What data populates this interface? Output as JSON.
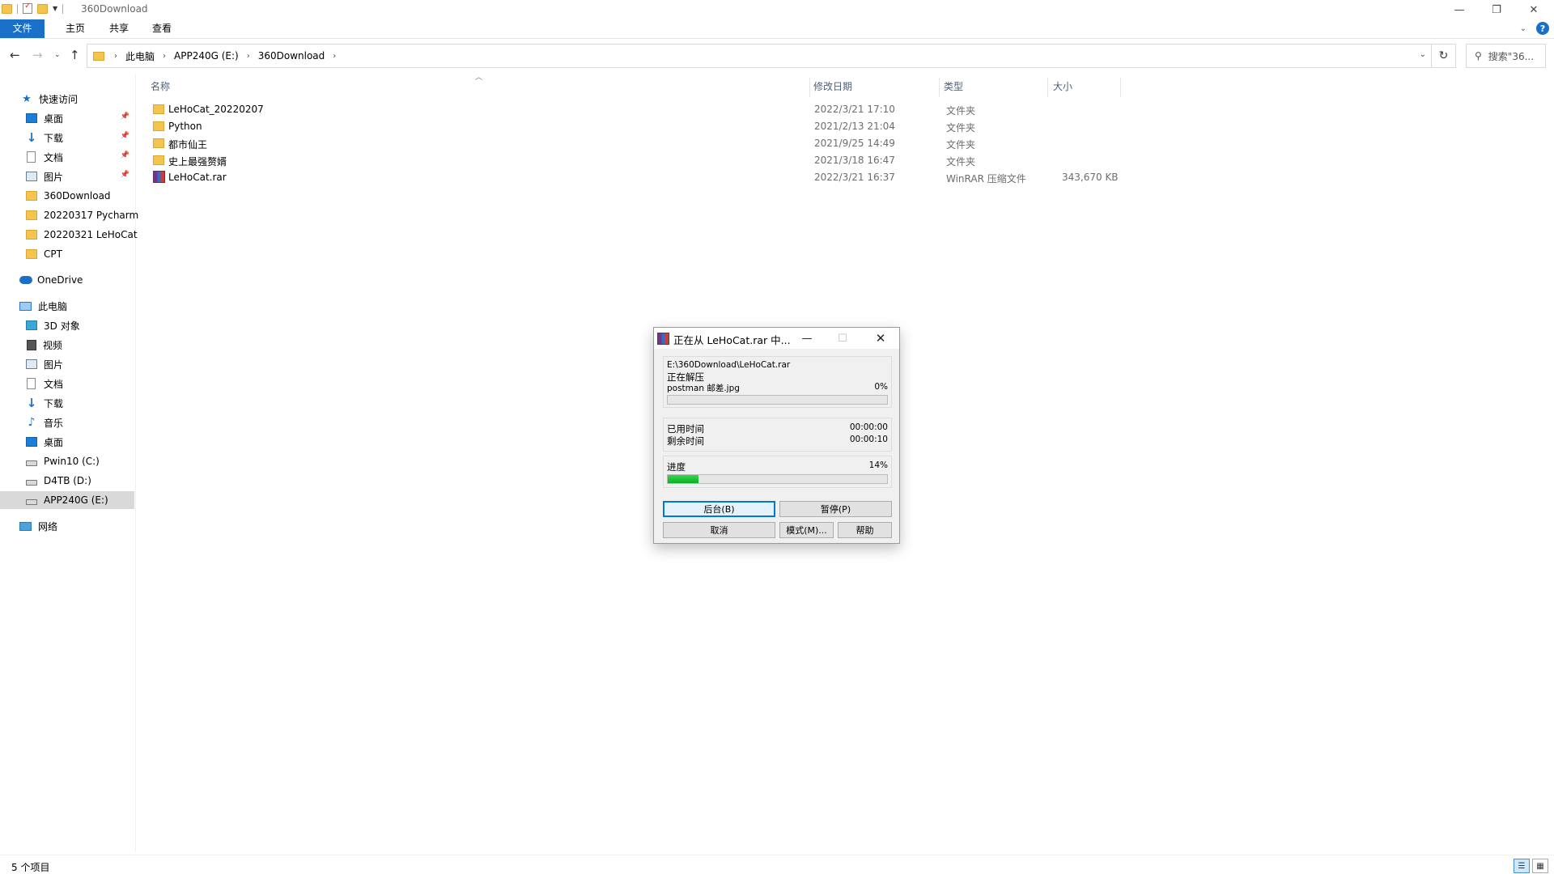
{
  "window": {
    "title": "360Download",
    "minimize_icon": "minimize-icon",
    "maximize_icon": "restore-icon",
    "close_icon": "close-icon"
  },
  "ribbon": {
    "tabs": [
      "文件",
      "主页",
      "共享",
      "查看"
    ],
    "accent": "#1a6fc9"
  },
  "nav": {
    "breadcrumbs": [
      "此电脑",
      "APP240G (E:)",
      "360Download"
    ],
    "search_placeholder": "搜索\"36..."
  },
  "sidebar": {
    "items": [
      {
        "label": "快速访问",
        "icon": "star-icon"
      },
      {
        "label": "桌面",
        "icon": "desktop-icon",
        "pinned": true
      },
      {
        "label": "下载",
        "icon": "download-icon",
        "pinned": true
      },
      {
        "label": "文档",
        "icon": "document-icon",
        "pinned": true
      },
      {
        "label": "图片",
        "icon": "picture-icon",
        "pinned": true
      },
      {
        "label": "360Download",
        "icon": "folder-icon"
      },
      {
        "label": "20220317 Pycharm",
        "icon": "folder-icon"
      },
      {
        "label": "20220321 LeHoCat",
        "icon": "folder-icon"
      },
      {
        "label": "CPT",
        "icon": "folder-icon"
      },
      {
        "label": "OneDrive",
        "icon": "cloud-icon"
      },
      {
        "label": "此电脑",
        "icon": "pc-icon"
      },
      {
        "label": "3D 对象",
        "icon": "3d-objects-icon"
      },
      {
        "label": "视频",
        "icon": "video-icon"
      },
      {
        "label": "图片",
        "icon": "picture-icon"
      },
      {
        "label": "文档",
        "icon": "document-icon"
      },
      {
        "label": "下载",
        "icon": "download-icon"
      },
      {
        "label": "音乐",
        "icon": "music-icon"
      },
      {
        "label": "桌面",
        "icon": "desktop-icon"
      },
      {
        "label": "Pwin10 (C:)",
        "icon": "system-drive-icon"
      },
      {
        "label": "D4TB (D:)",
        "icon": "drive-icon"
      },
      {
        "label": "APP240G (E:)",
        "icon": "drive-icon",
        "selected": true
      },
      {
        "label": "网络",
        "icon": "network-icon"
      }
    ]
  },
  "filelist": {
    "columns": [
      "名称",
      "修改日期",
      "类型",
      "大小"
    ],
    "rows": [
      {
        "name": "LeHoCat_20220207",
        "date": "2022/3/21 17:10",
        "type": "文件夹",
        "size": "",
        "icon": "folder-icon"
      },
      {
        "name": "Python",
        "date": "2021/2/13 21:04",
        "type": "文件夹",
        "size": "",
        "icon": "folder-icon"
      },
      {
        "name": "都市仙王",
        "date": "2021/9/25 14:49",
        "type": "文件夹",
        "size": "",
        "icon": "folder-icon"
      },
      {
        "name": "史上最强赘婿",
        "date": "2021/3/18 16:47",
        "type": "文件夹",
        "size": "",
        "icon": "folder-icon"
      },
      {
        "name": "LeHoCat.rar",
        "date": "2022/3/21 16:37",
        "type": "WinRAR 压缩文件",
        "size": "343,670 KB",
        "icon": "winrar-icon"
      }
    ]
  },
  "status": {
    "count": "5 个项目"
  },
  "dialog": {
    "title": "正在从 LeHoCat.rar 中...",
    "archive_path": "E:\\360Download\\LeHoCat.rar",
    "action": "正在解压",
    "current_file": "postman 邮差.jpg",
    "file_percent": "0%",
    "file_progress": 0,
    "elapsed_label": "已用时间",
    "elapsed_value": "00:00:00",
    "remaining_label": "剩余时间",
    "remaining_value": "00:00:10",
    "progress_label": "进度",
    "total_percent": "14%",
    "total_progress": 0.14,
    "buttons": {
      "background": "后台(B)",
      "pause": "暂停(P)",
      "cancel": "取消",
      "mode": "模式(M)...",
      "help": "帮助"
    },
    "progress_color": "#06b025"
  }
}
